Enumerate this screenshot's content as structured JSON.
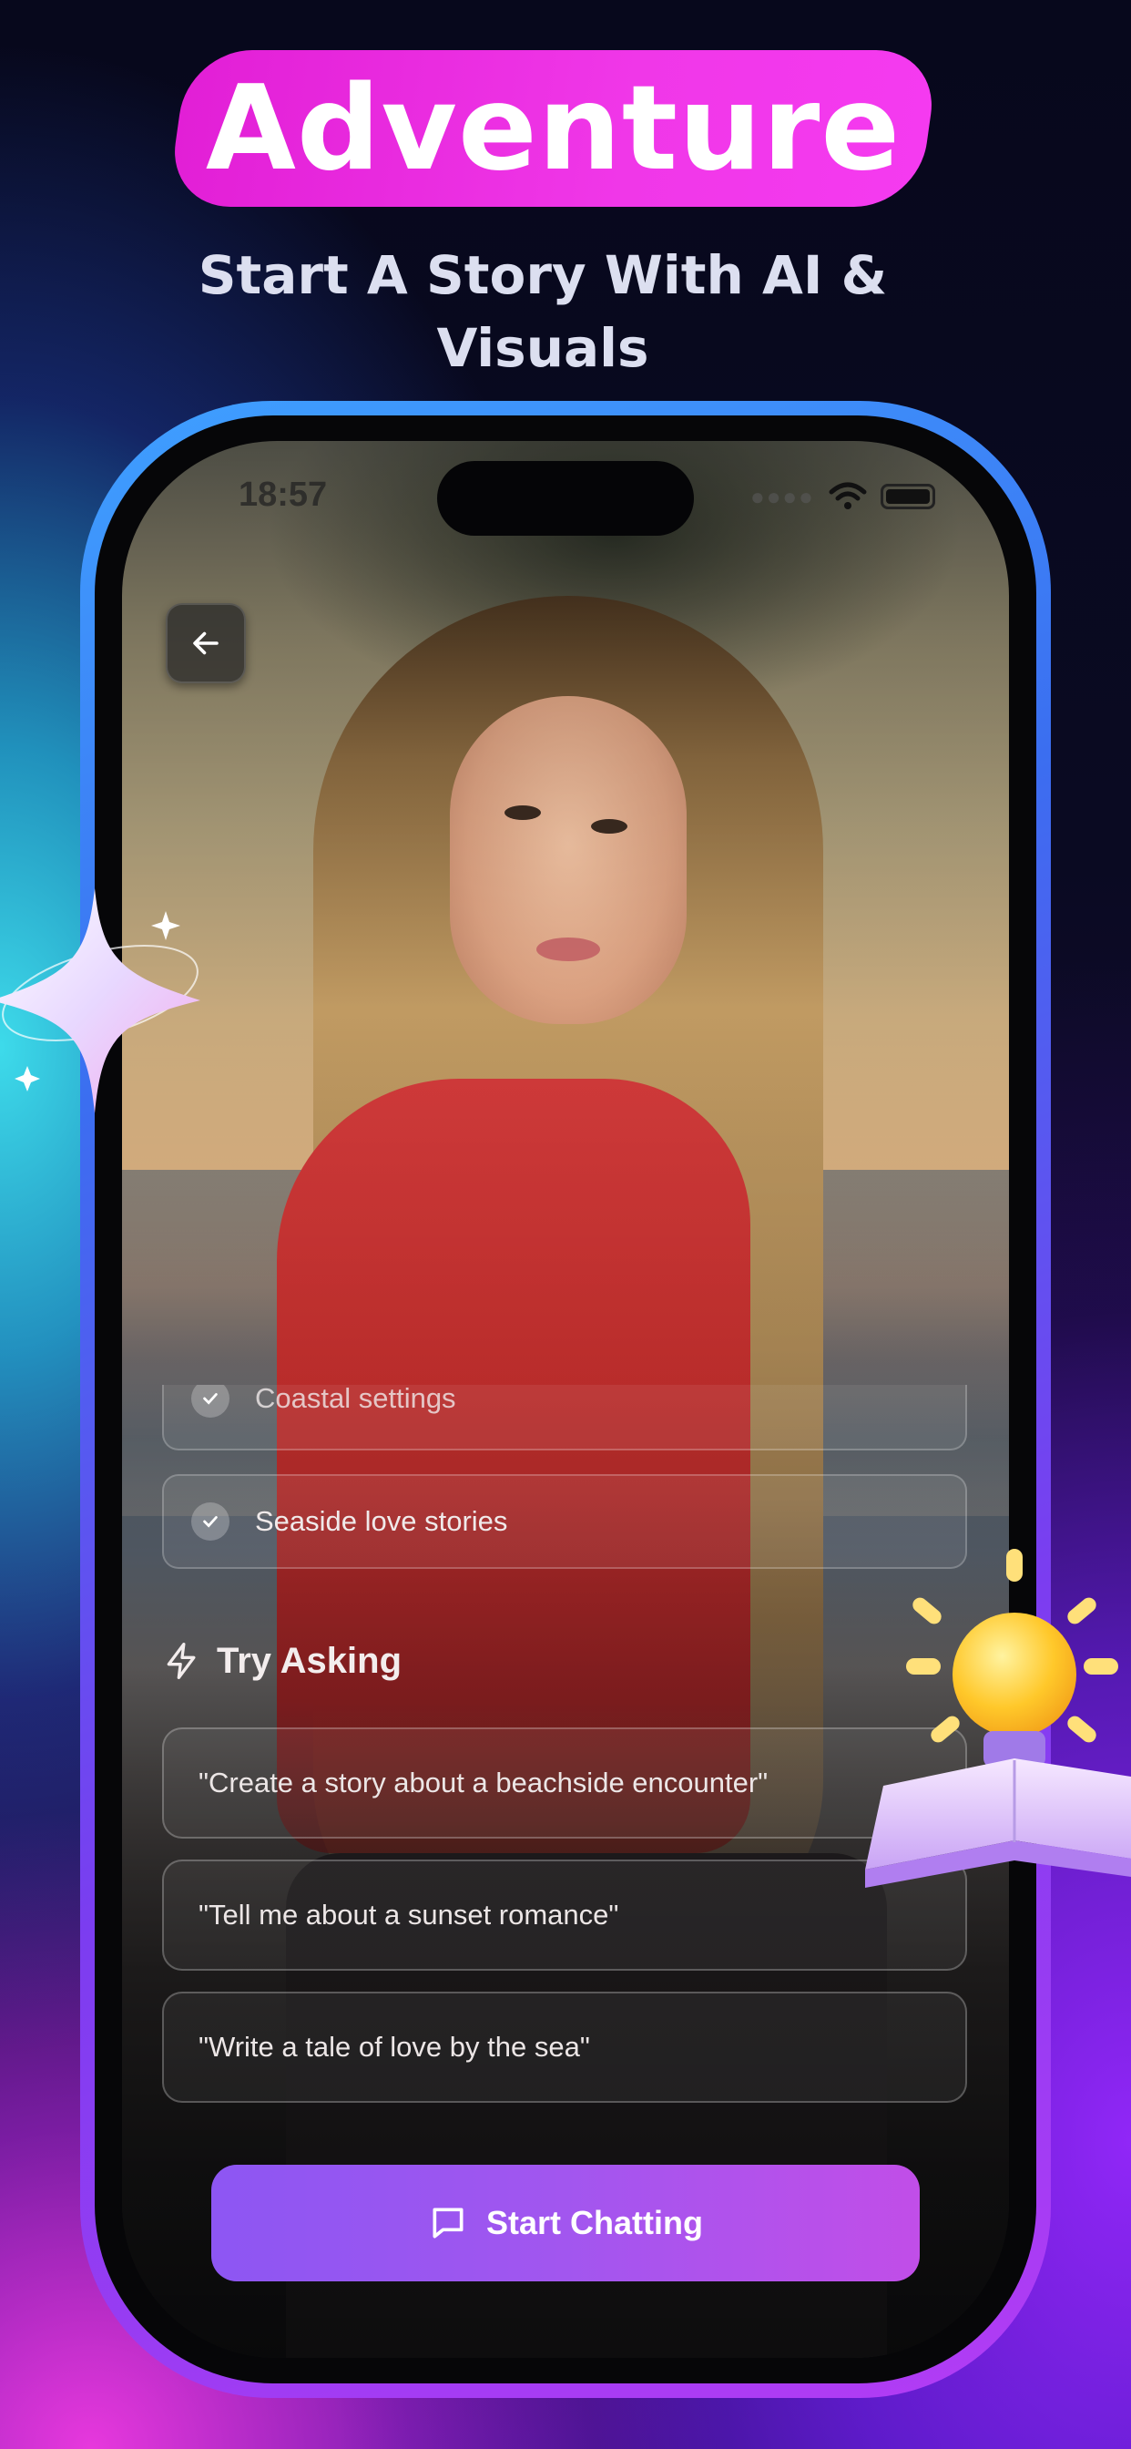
{
  "promo": {
    "headline": "Adventure",
    "subheadline": "Start A Story With AI & Visuals"
  },
  "status_bar": {
    "time": "18:57",
    "signal": "wifi-icon",
    "battery": "battery-icon"
  },
  "nav": {
    "back_icon": "arrow-left-icon"
  },
  "options": [
    {
      "label": "Coastal settings",
      "icon": "check-icon"
    },
    {
      "label": "Seaside love stories",
      "icon": "check-icon"
    }
  ],
  "try_asking": {
    "title": "Try Asking",
    "icon": "lightning-icon",
    "prompts": [
      "\"Create a story about a beachside encounter\"",
      "\"Tell me about a sunset romance\"",
      "\"Write a tale of love by the sea\""
    ]
  },
  "cta": {
    "label": "Start Chatting",
    "icon": "chat-bubble-icon"
  },
  "colors": {
    "headline_pill": "#f037e8",
    "cta_start": "#8d56f3",
    "cta_end": "#c14ee8"
  }
}
